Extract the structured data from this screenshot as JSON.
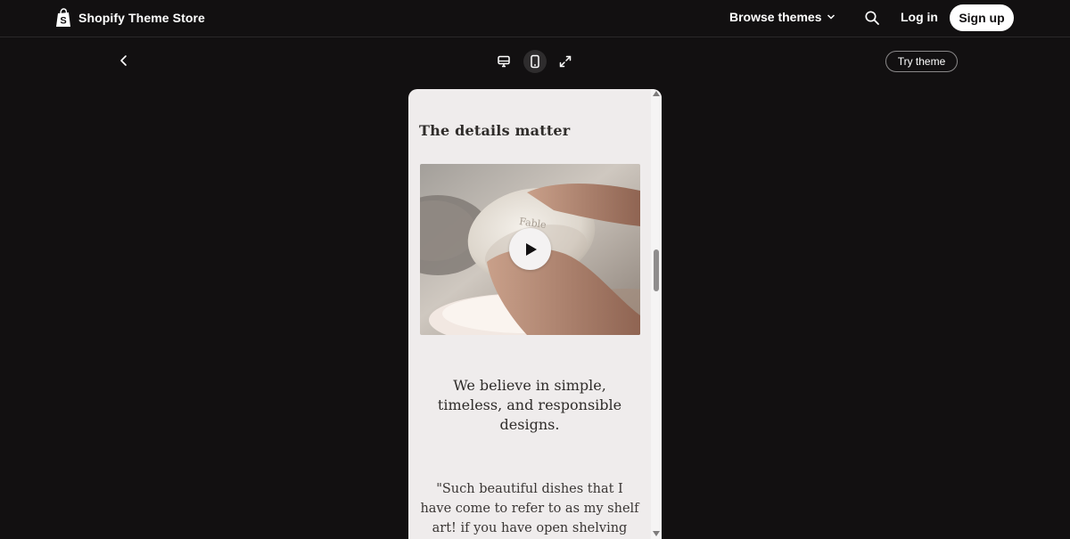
{
  "header": {
    "brand_name": "Shopify Theme Store",
    "browse_label": "Browse themes",
    "login_label": "Log in",
    "signup_label": "Sign up"
  },
  "toolbar": {
    "try_theme_label": "Try theme",
    "active_device": "mobile"
  },
  "preview": {
    "details_heading": "The details matter",
    "video_watermark": "Fable",
    "belief_text": "We believe in simple, timeless, and responsible designs.",
    "quote_text": "\"Such beautiful dishes that I have come to refer to as my shelf art! if you have open shelving"
  },
  "icons": {
    "brand": "shopify-bag-icon",
    "browse": "chevron-down-icon",
    "search": "search-icon",
    "back": "chevron-left-icon",
    "desktop": "desktop-icon",
    "mobile": "mobile-icon",
    "fullscreen": "expand-icon",
    "play": "play-icon"
  },
  "colors": {
    "background": "#121011",
    "preview_background": "#efecec",
    "button_light": "#ffffff",
    "text_dark": "#2f2c2a"
  }
}
